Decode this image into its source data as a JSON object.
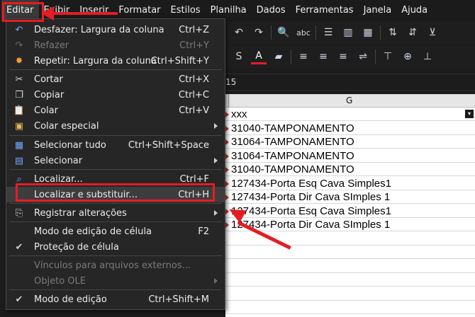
{
  "menubar": {
    "items": [
      "Editar",
      "Exibir",
      "Inserir",
      "Formatar",
      "Estilos",
      "Planilha",
      "Dados",
      "Ferramentas",
      "Janela",
      "Ajuda"
    ]
  },
  "formula": {
    "cell_ref": "15"
  },
  "sheet": {
    "column_label": "G",
    "rows": [
      "xxx",
      "31040-TAMPONAMENTO",
      "31064-TAMPONAMENTO",
      "31064-TAMPONAMENTO",
      "31040-TAMPONAMENTO",
      "127434-Porta Esq Cava Simples1",
      "127434-Porta Dir Cava SImples 1",
      "127434-Porta Esq Cava Simples1",
      "127434-Porta Dir Cava SImples 1"
    ]
  },
  "edit_menu": {
    "items": [
      {
        "label": "Desfazer: Largura da coluna",
        "shortcut": "Ctrl+Z",
        "icon": "undo-icon"
      },
      {
        "label": "Refazer",
        "shortcut": "Ctrl+Y",
        "icon": "redo-icon"
      },
      {
        "label": "Repetir: Largura da coluna",
        "shortcut": "Ctrl+Shift+Y",
        "icon": "repeat-icon"
      },
      {
        "label": "Cortar",
        "shortcut": "Ctrl+X",
        "icon": "scissors-icon"
      },
      {
        "label": "Copiar",
        "shortcut": "Ctrl+C",
        "icon": "copy-icon"
      },
      {
        "label": "Colar",
        "shortcut": "Ctrl+V",
        "icon": "paste-icon"
      },
      {
        "label": "Colar especial",
        "shortcut": "",
        "icon": "paste-special-icon"
      },
      {
        "label": "Selecionar tudo",
        "shortcut": "Ctrl+Shift+Space",
        "icon": "select-all-icon"
      },
      {
        "label": "Selecionar",
        "shortcut": "",
        "icon": "select-icon"
      },
      {
        "label": "Localizar...",
        "shortcut": "Ctrl+F",
        "icon": "search-icon"
      },
      {
        "label": "Localizar e substituir...",
        "shortcut": "Ctrl+H",
        "icon": "find-replace-icon"
      },
      {
        "label": "Registrar alterações",
        "shortcut": "",
        "icon": "track-changes-icon"
      },
      {
        "label": "Modo de edição de célula",
        "shortcut": "F2",
        "icon": ""
      },
      {
        "label": "Proteção de célula",
        "shortcut": "",
        "icon": "check-icon"
      },
      {
        "label": "Vínculos para arquivos externos...",
        "shortcut": "",
        "icon": ""
      },
      {
        "label": "Objeto OLE",
        "shortcut": "",
        "icon": ""
      },
      {
        "label": "Modo de edição",
        "shortcut": "Ctrl+Shift+M",
        "icon": "check-icon"
      }
    ]
  },
  "colors": {
    "annotation": "#e51c23",
    "menu_bg": "#262626",
    "sheet_bg": "#ffffff"
  }
}
